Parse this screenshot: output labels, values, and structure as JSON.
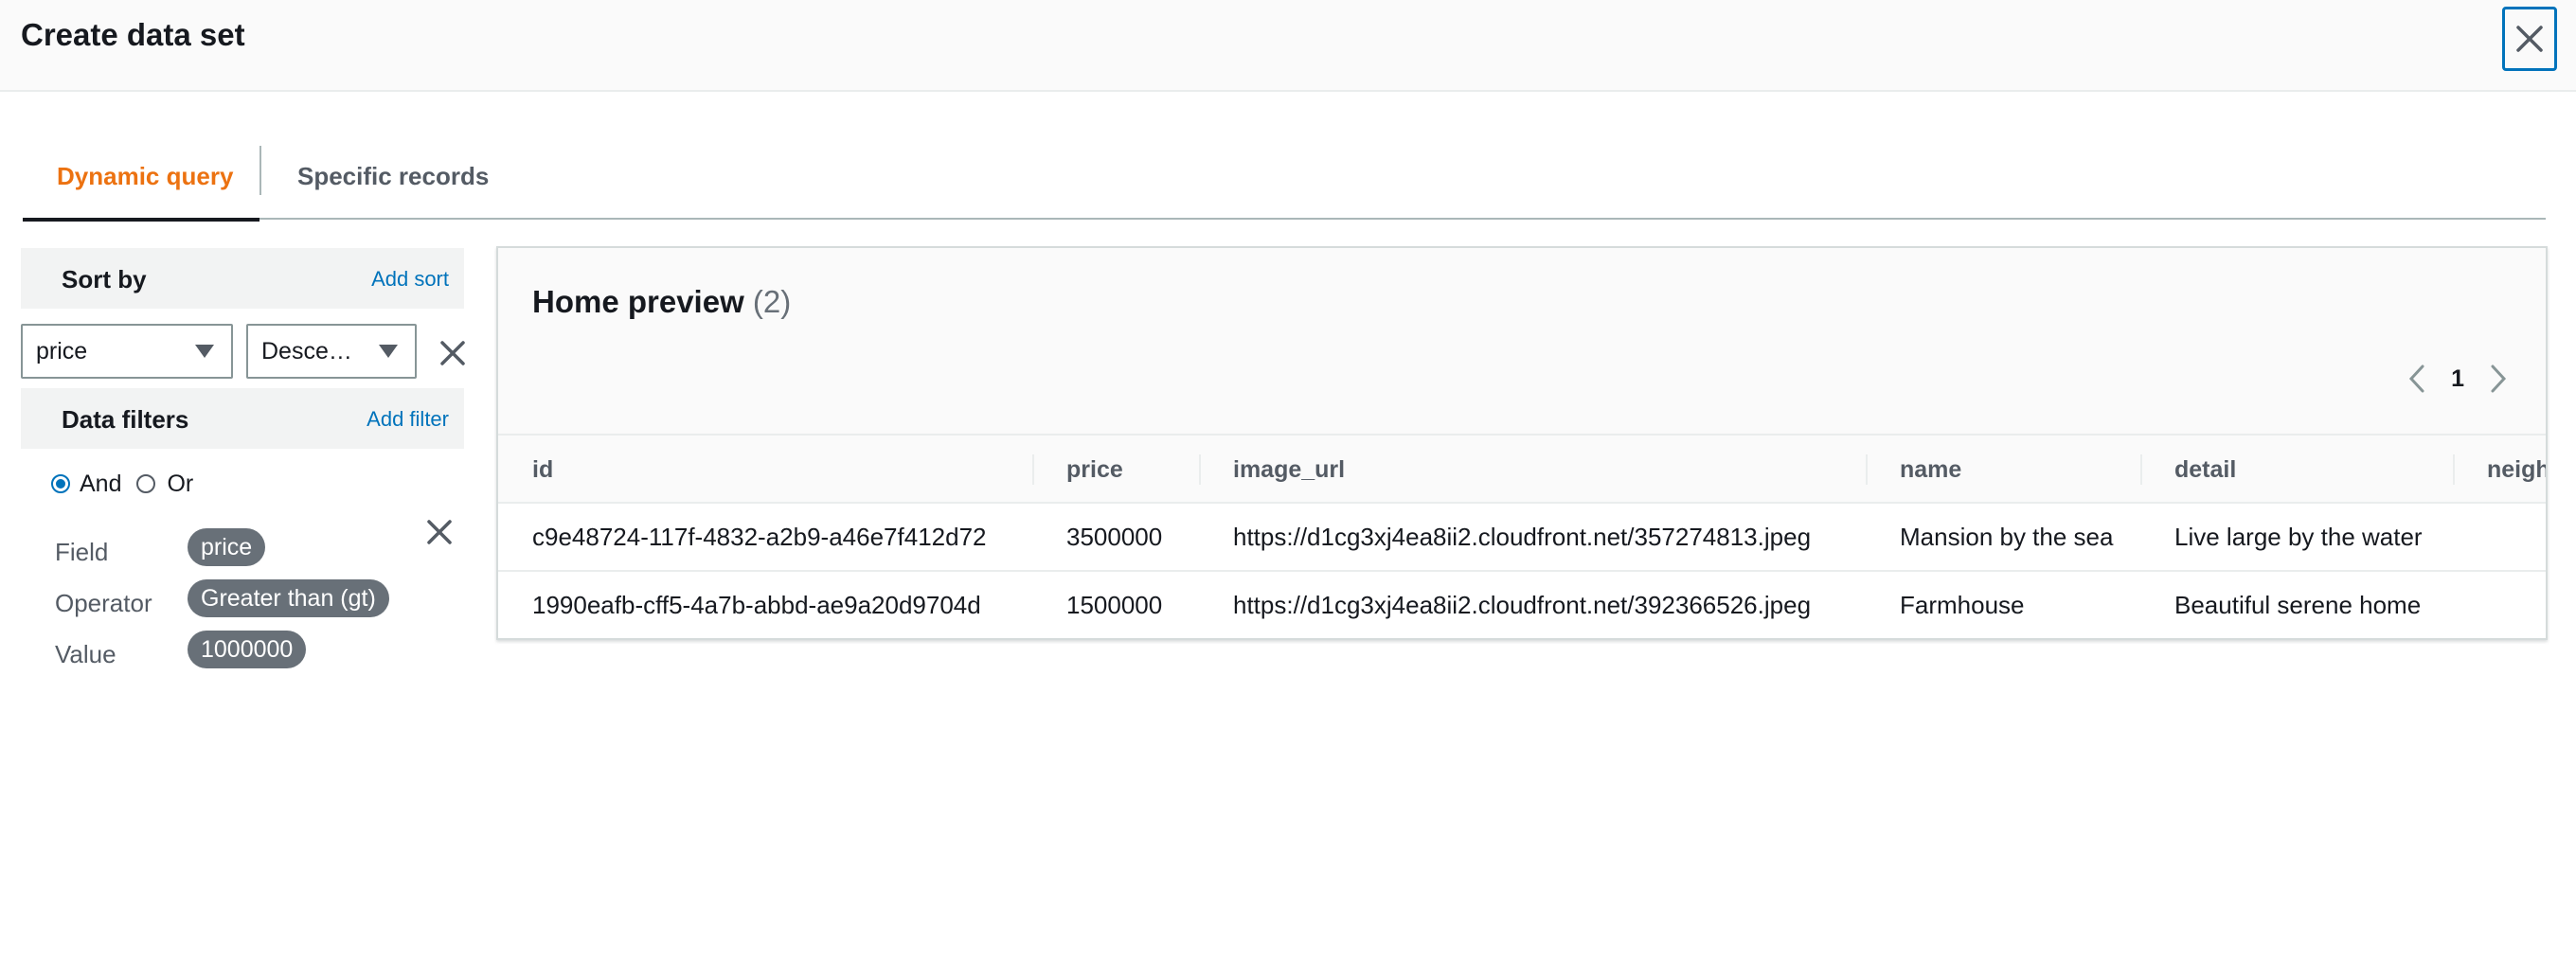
{
  "modal": {
    "title": "Create data set"
  },
  "tabs": [
    {
      "label": "Dynamic query",
      "active": true
    },
    {
      "label": "Specific records",
      "active": false
    }
  ],
  "sort": {
    "title": "Sort by",
    "add_label": "Add sort",
    "field_value": "price",
    "order_value": "Desce…"
  },
  "filters": {
    "title": "Data filters",
    "add_label": "Add filter",
    "logic": {
      "and_label": "And",
      "or_label": "Or",
      "selected": "And"
    },
    "field_label": "Field",
    "operator_label": "Operator",
    "value_label": "Value",
    "field_token": "price",
    "operator_token": "Greater than (gt)",
    "value_token": "1000000"
  },
  "preview": {
    "title": "Home preview",
    "count": "(2)",
    "page": "1",
    "columns": [
      "id",
      "price",
      "image_url",
      "name",
      "detail",
      "neigh"
    ],
    "rows": [
      [
        "c9e48724-117f-4832-a2b9-a46e7f412d72",
        "3500000",
        "https://d1cg3xj4ea8ii2.cloudfront.net/357274813.jpeg",
        "Mansion by the sea",
        "Live large by the water",
        ""
      ],
      [
        "1990eafb-cff5-4a7b-abbd-ae9a20d9704d",
        "1500000",
        "https://d1cg3xj4ea8ii2.cloudfront.net/392366526.jpeg",
        "Farmhouse",
        "Beautiful serene home",
        ""
      ]
    ]
  },
  "colors": {
    "accent": "#ec7211",
    "link": "#0073bb",
    "token": "#687078"
  }
}
